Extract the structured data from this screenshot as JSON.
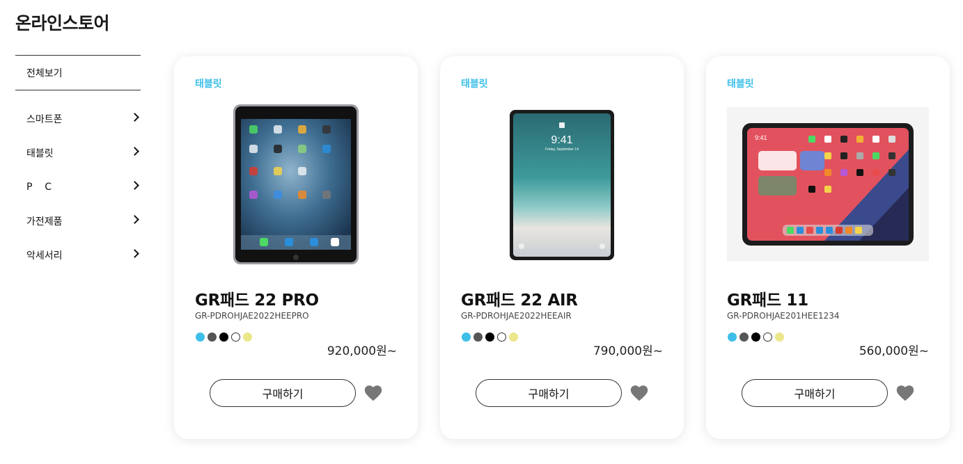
{
  "page": {
    "title": "온라인스토어"
  },
  "sidebar": {
    "all_label": "전체보기",
    "items": [
      {
        "label": "스마트폰"
      },
      {
        "label": "태블릿"
      },
      {
        "label": "P    C"
      },
      {
        "label": "가전제품"
      },
      {
        "label": "악세서리"
      }
    ]
  },
  "products": [
    {
      "category": "태블릿",
      "name": "GR패드 22 PRO",
      "sku": "GR-PDROHJAE2022HEEPRO",
      "price": "920,000원~",
      "buy_label": "구매하기",
      "colors": [
        "#3dbfe8",
        "#555555",
        "#000000",
        "#ffffff",
        "#ece68a"
      ],
      "image_icon": "tablet-pro-image"
    },
    {
      "category": "태블릿",
      "name": "GR패드 22 AIR",
      "sku": "GR-PDROHJAE2022HEEAIR",
      "price": "790,000원~",
      "buy_label": "구매하기",
      "colors": [
        "#3dbfe8",
        "#555555",
        "#000000",
        "#ffffff",
        "#ece68a"
      ],
      "image_icon": "tablet-air-image"
    },
    {
      "category": "태블릿",
      "name": "GR패드 11",
      "sku": "GR-PDROHJAE201HEE1234",
      "price": "560,000원~",
      "buy_label": "구매하기",
      "colors": [
        "#3dbfe8",
        "#555555",
        "#000000",
        "#ffffff",
        "#ece68a"
      ],
      "image_icon": "tablet-11-image"
    }
  ],
  "theme": {
    "accent": "#3dbfe8",
    "heart": "#777777"
  }
}
